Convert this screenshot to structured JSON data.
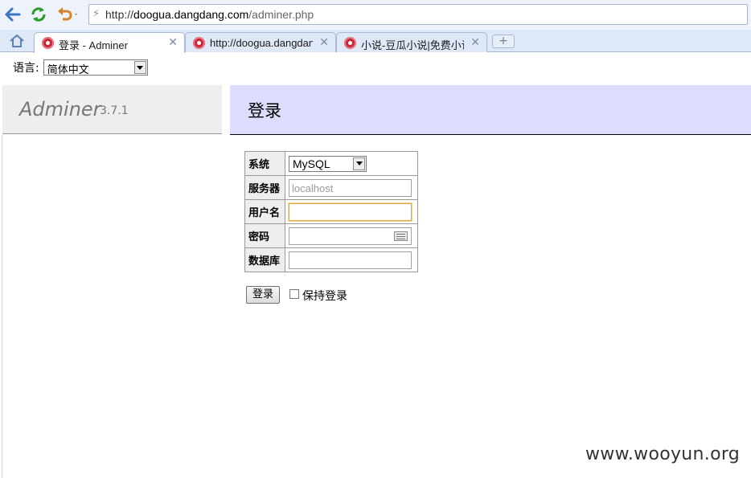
{
  "browser": {
    "url_scheme": "http://",
    "url_host": "doogua.dangdang.com",
    "url_path": "/adminer.php",
    "tabs": [
      {
        "title": "登录 - Adminer",
        "active": true
      },
      {
        "title": "http://doogua.dangdang",
        "active": false
      },
      {
        "title": "小说-豆瓜小说|免费小说",
        "active": false
      }
    ],
    "new_tab_label": "+"
  },
  "language": {
    "label": "语言:",
    "selected": "简体中文"
  },
  "adminer": {
    "name": "Adminer",
    "version": "3.7.1",
    "page_title": "登录"
  },
  "login_form": {
    "system_label": "系统",
    "system_value": "MySQL",
    "server_label": "服务器",
    "server_placeholder": "localhost",
    "username_label": "用户名",
    "username_value": "",
    "password_label": "密码",
    "database_label": "数据库",
    "database_value": "",
    "submit_label": "登录",
    "permanent_label": "保持登录"
  },
  "watermark": "www.wooyun.org",
  "colors": {
    "header_bg": "#ddddff",
    "brand_bg": "#eeeeee",
    "focus_border": "#e0a93d",
    "reload_green": "#2f9b2f",
    "back_blue": "#3a76c4",
    "undo_orange": "#d9822b"
  }
}
